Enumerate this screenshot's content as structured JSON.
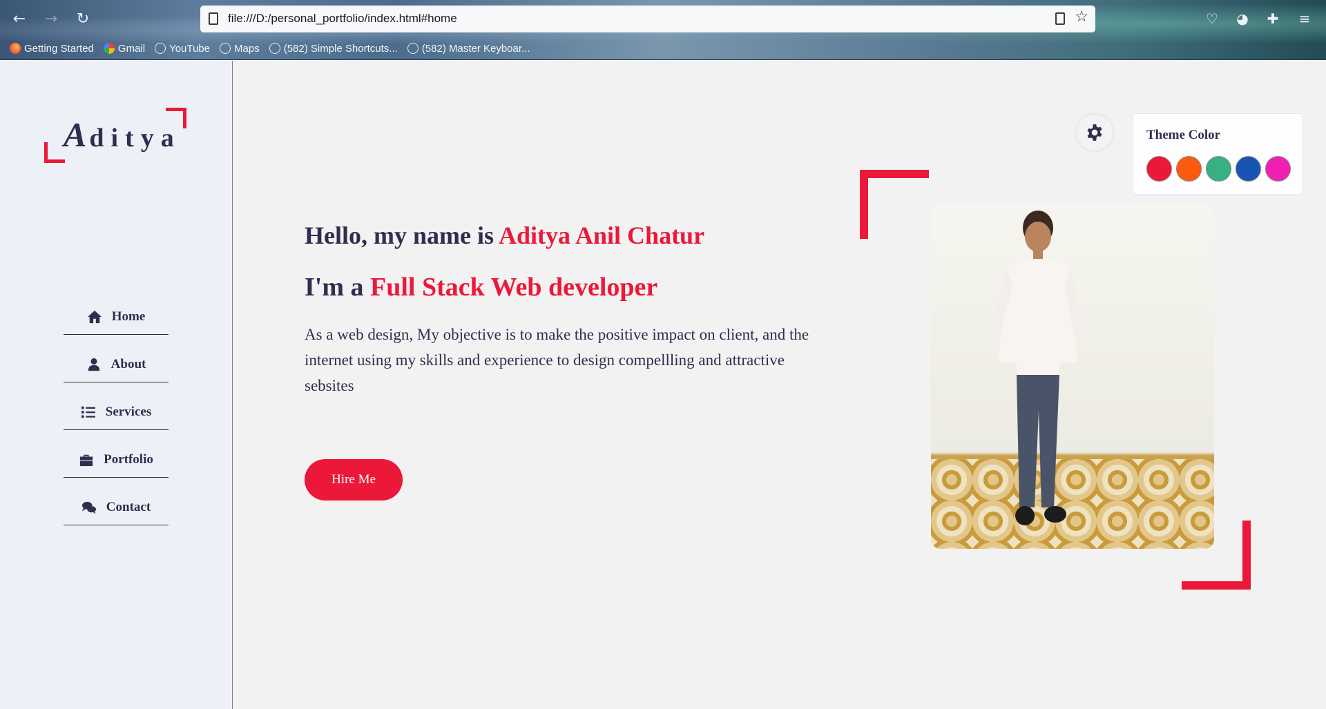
{
  "browser": {
    "url": "file:///D:/personal_portfolio/index.html#home",
    "bookmarks": [
      {
        "label": "Getting Started",
        "icon": "firefox-icon"
      },
      {
        "label": "Gmail",
        "icon": "google-icon"
      },
      {
        "label": "YouTube",
        "icon": "globe-icon"
      },
      {
        "label": "Maps",
        "icon": "globe-icon"
      },
      {
        "label": "(582) Simple Shortcuts...",
        "icon": "globe-icon"
      },
      {
        "label": "(582) Master Keyboar...",
        "icon": "globe-icon"
      }
    ]
  },
  "sidebar": {
    "logo_letter": "A",
    "logo_rest": "ditya",
    "menu": [
      {
        "label": "Home",
        "icon": "home-icon"
      },
      {
        "label": "About",
        "icon": "user-icon"
      },
      {
        "label": "Services",
        "icon": "list-icon"
      },
      {
        "label": "Portfolio",
        "icon": "briefcase-icon"
      },
      {
        "label": "Contact",
        "icon": "comments-icon"
      }
    ]
  },
  "hero": {
    "greeting_prefix": "Hello, my name is ",
    "name": "Aditya Anil Chatur",
    "role_prefix": "I'm a ",
    "role": "Full Stack Web developer",
    "description": "As a web design, My objective is to make the positive impact on client, and the internet using my skills and experience to design compellling and attractive sebsites",
    "hire_button": "Hire Me"
  },
  "theme": {
    "title": "Theme Color",
    "colors": [
      "#ec1839",
      "#fa5b0f",
      "#37b182",
      "#1854b4",
      "#f021b2"
    ],
    "accent": "#ec1839",
    "text": "#302e4d"
  }
}
